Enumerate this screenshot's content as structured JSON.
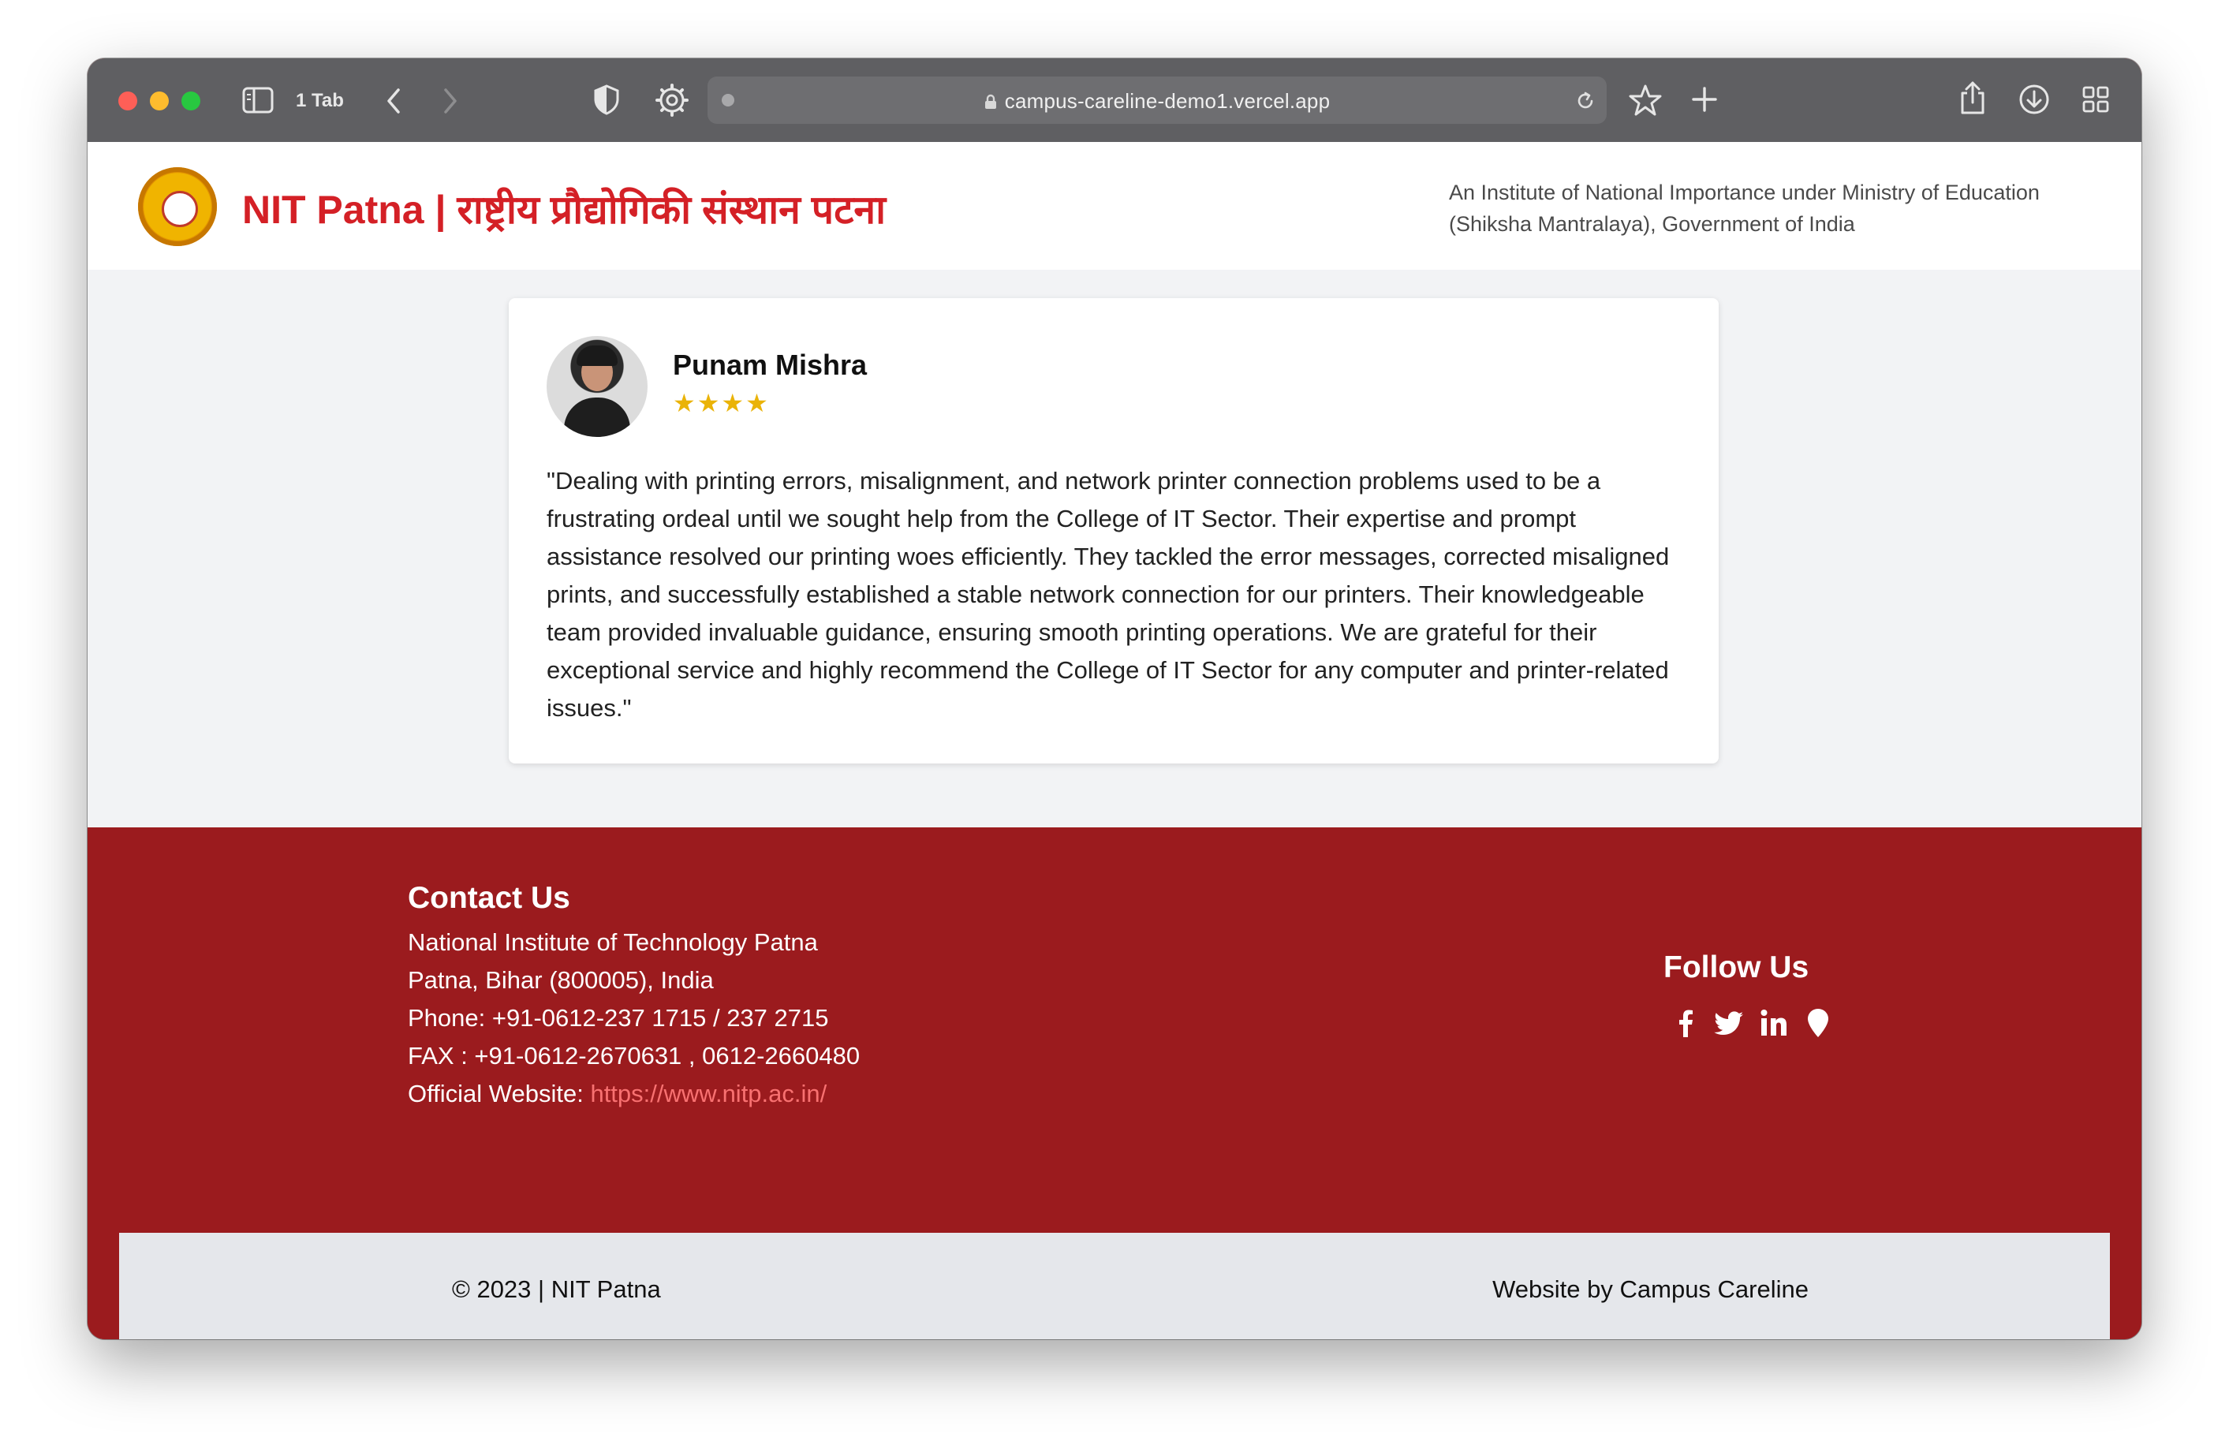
{
  "browser": {
    "tab_count_label": "1 Tab",
    "url": "campus-careline-demo1.vercel.app"
  },
  "header": {
    "title": "NIT Patna | राष्ट्रीय प्रौद्योगिकी संस्थान पटना",
    "subtitle_line1": "An Institute of National Importance under Ministry of Education",
    "subtitle_line2": "(Shiksha Mantralaya), Government of India"
  },
  "review": {
    "name": "Punam Mishra",
    "rating": 4,
    "stars": "★★★★",
    "text": "\"Dealing with printing errors, misalignment, and network printer connection problems used to be a frustrating ordeal until we sought help from the College of IT Sector. Their expertise and prompt assistance resolved our printing woes efficiently. They tackled the error messages, corrected misaligned prints, and successfully established a stable network connection for our printers. Their knowledgeable team provided invaluable guidance, ensuring smooth printing operations. We are grateful for their exceptional service and highly recommend the College of IT Sector for any computer and printer-related issues.\""
  },
  "footer": {
    "contact_title": "Contact Us",
    "address_line1": "National Institute of Technology Patna",
    "address_line2": "Patna, Bihar (800005), India",
    "phone": "Phone: +91-0612-237 1715 / 237 2715",
    "fax": "FAX : +91-0612-2670631 , 0612-2660480",
    "website_label": "Official Website: ",
    "website_link": "https://www.nitp.ac.in/",
    "follow_title": "Follow Us",
    "social_icons": [
      "facebook-icon",
      "twitter-icon",
      "linkedin-icon",
      "location-icon"
    ],
    "copyright": "© 2023 | NIT Patna",
    "credit": "Website by Campus Careline"
  },
  "colors": {
    "brand_red": "#d42026",
    "footer_red": "#9b1b1e",
    "star_yellow": "#eab308",
    "link_red": "#f87171"
  }
}
